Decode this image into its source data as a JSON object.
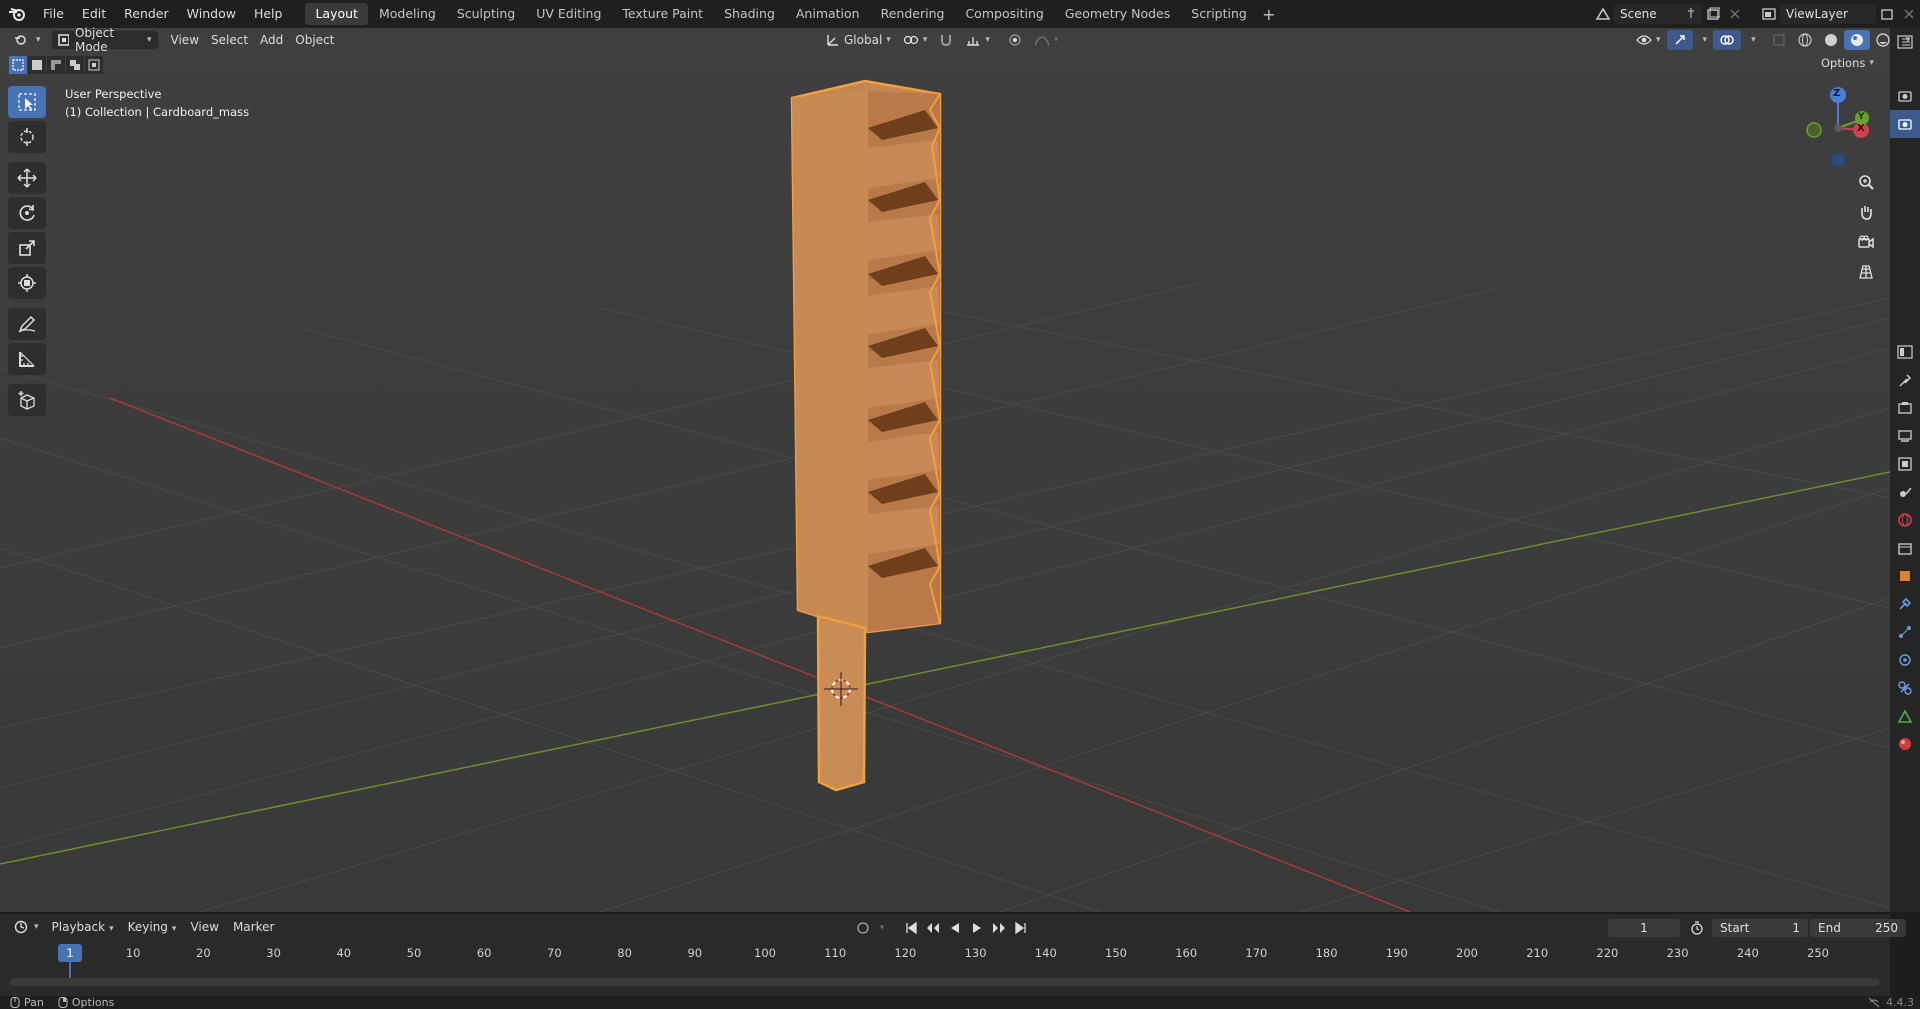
{
  "topbar": {
    "menus": [
      "File",
      "Edit",
      "Render",
      "Window",
      "Help"
    ],
    "workspaces": [
      "Layout",
      "Modeling",
      "Sculpting",
      "UV Editing",
      "Texture Paint",
      "Shading",
      "Animation",
      "Rendering",
      "Compositing",
      "Geometry Nodes",
      "Scripting"
    ],
    "active_workspace": "Layout",
    "scene_name": "Scene",
    "view_layer": "ViewLayer"
  },
  "viewport_header": {
    "mode": "Object Mode",
    "menus": [
      "View",
      "Select",
      "Add",
      "Object"
    ],
    "orientation": "Global",
    "options_label": "Options"
  },
  "viewport": {
    "perspective_label": "User Perspective",
    "collection_label": "(1) Collection | Cardboard_mass",
    "object_color": "#c68a4e",
    "selection_outline_color": "#f0a040",
    "axis_x_color": "#c23a3a",
    "axis_y_color": "#6a9a2a"
  },
  "gizmo": {
    "z_label": "Z",
    "x_label": "X",
    "y_label": "Y"
  },
  "timeline": {
    "menus": [
      "Playback",
      "Keying",
      "View",
      "Marker"
    ],
    "current_frame": "1",
    "start_label": "Start",
    "start_value": "1",
    "end_label": "End",
    "end_value": "250",
    "ticks": [
      "10",
      "20",
      "30",
      "40",
      "50",
      "60",
      "70",
      "80",
      "90",
      "100",
      "110",
      "120",
      "130",
      "140",
      "150",
      "160",
      "170",
      "180",
      "190",
      "200",
      "210",
      "220",
      "230",
      "240",
      "250"
    ]
  },
  "statusbar": {
    "pan": "Pan",
    "options": "Options",
    "version": "4.4.3"
  }
}
